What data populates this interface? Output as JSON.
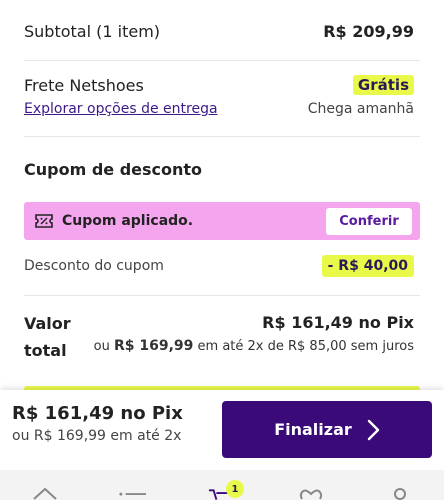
{
  "summary": {
    "subtotal_label": "Subtotal (1 item)",
    "subtotal_value": "R$ 209,99",
    "shipping_label": "Frete Netshoes",
    "shipping_value": "Grátis",
    "shipping_link": "Explorar opções de entrega",
    "shipping_eta": "Chega amanhã"
  },
  "coupon": {
    "section_title": "Cupom de desconto",
    "applied_text": "Cupom aplicado.",
    "check_button": "Conferir",
    "icon": "ticket-icon",
    "discount_label": "Desconto do cupom",
    "discount_value": "- R$ 40,00"
  },
  "total": {
    "label": "Valor total",
    "pix_value": "R$ 161,49 no Pix",
    "inst_prefix": "ou",
    "inst_amount": "R$ 169,99",
    "inst_suffix": "em até 2x de R$ 85,00 sem juros"
  },
  "bottom_bar": {
    "pix_value": "R$ 161,49 no Pix",
    "installment_text": "ou R$ 169,99 em até 2x",
    "finalize_button": "Finalizar"
  },
  "tabbar": {
    "cart_count": "1",
    "icons": [
      "home-icon",
      "menu-icon",
      "cart-icon",
      "heart-icon",
      "user-icon"
    ]
  },
  "colors": {
    "accent_yellow": "#e9f94a",
    "coupon_pink": "#f4a5ee",
    "brand_purple": "#3a0a78",
    "link_purple": "#3d1a8a"
  }
}
